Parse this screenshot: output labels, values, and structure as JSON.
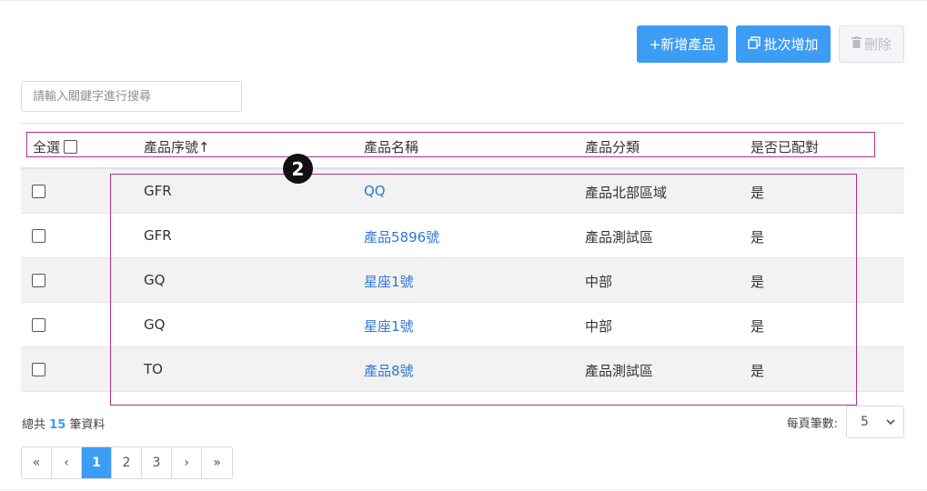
{
  "toolbar": {
    "add_label": "+新增產品",
    "batch_label": "批次增加",
    "delete_label": "刪除"
  },
  "search": {
    "placeholder": "請輸入關鍵字進行搜尋"
  },
  "table": {
    "headers": {
      "select_all": "全選",
      "code": "產品序號↑",
      "name": "產品名稱",
      "category": "產品分類",
      "paired": "是否已配對"
    },
    "rows": [
      {
        "code": "GFR",
        "name": "QQ",
        "category": "產品北部區域",
        "paired": "是"
      },
      {
        "code": "GFR",
        "name": "產品5896號",
        "category": "產品測試區",
        "paired": "是"
      },
      {
        "code": "GQ",
        "name": "星座1號",
        "category": "中部",
        "paired": "是"
      },
      {
        "code": "GQ",
        "name": "星座1號",
        "category": "中部",
        "paired": "是"
      },
      {
        "code": "TO",
        "name": "產品8號",
        "category": "產品測試區",
        "paired": "是"
      }
    ]
  },
  "footer": {
    "total_prefix": "總共",
    "total_count": "15",
    "total_suffix": "筆資料",
    "per_page_label": "每頁筆數:",
    "per_page_value": "5"
  },
  "pagination": {
    "first": "«",
    "prev": "‹",
    "pages": [
      "1",
      "2",
      "3"
    ],
    "next": "›",
    "last": "»",
    "current": "1"
  },
  "annotation": {
    "marker": "2"
  },
  "colors": {
    "primary": "#3d9cf3",
    "link": "#2f77d6",
    "annotation": "#b02f8f"
  }
}
